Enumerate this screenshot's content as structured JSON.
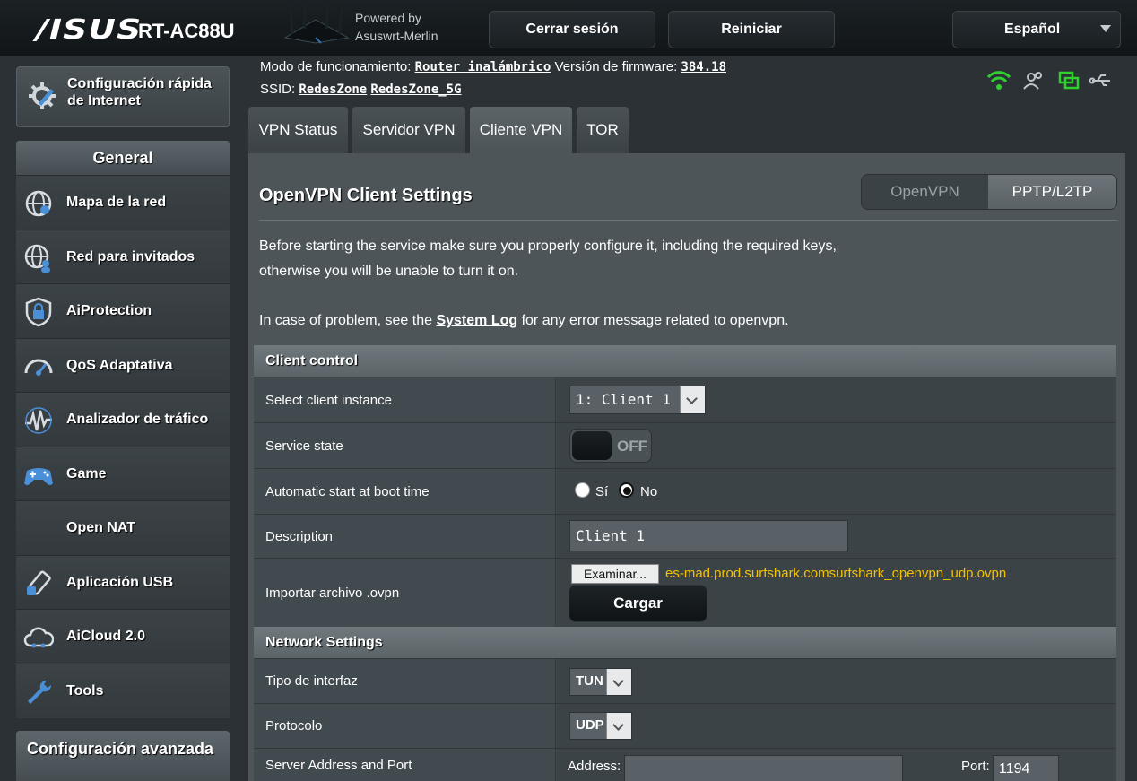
{
  "header": {
    "logo": "/ISUS",
    "model": "RT-AC88U",
    "powered_line1": "Powered by",
    "powered_line2": "Asuswrt-Merlin",
    "logout": "Cerrar sesión",
    "reboot": "Reiniciar",
    "language": "Español"
  },
  "sidebar": {
    "quick_setup": "Configuración rápida de Internet",
    "general_header": "General",
    "items": [
      {
        "label": "Mapa de la red",
        "icon": "network-map-icon"
      },
      {
        "label": "Red para invitados",
        "icon": "guest-network-icon"
      },
      {
        "label": "AiProtection",
        "icon": "aiprotection-lock-icon"
      },
      {
        "label": "QoS Adaptativa",
        "icon": "qos-gauge-icon"
      },
      {
        "label": "Analizador de tráfico",
        "icon": "traffic-analyzer-icon"
      },
      {
        "label": "Game",
        "icon": "gamepad-icon"
      },
      {
        "label": "Open NAT",
        "icon": ""
      },
      {
        "label": "Aplicación USB",
        "icon": "usb-application-icon"
      },
      {
        "label": "AiCloud 2.0",
        "icon": "cloud-icon"
      },
      {
        "label": "Tools",
        "icon": "wrench-icon"
      }
    ],
    "advanced_header": "Configuración avanzada"
  },
  "info": {
    "mode_label": "Modo de funcionamiento:",
    "mode_value": "Router inalámbrico",
    "fw_label": "Versión de firmware:",
    "fw_value": "384.18",
    "ssid_label": "SSID:",
    "ssid_1": "RedesZone",
    "ssid_2": "RedesZone_5G"
  },
  "tabs": [
    "VPN Status",
    "Servidor VPN",
    "Cliente VPN",
    "TOR"
  ],
  "panel": {
    "title": "OpenVPN Client Settings",
    "seg_openvpn": "OpenVPN",
    "seg_pptp": "PPTP/L2TP",
    "desc_line1": "Before starting the service make sure you properly configure it, including the required keys,",
    "desc_line2": "otherwise you will be unable to turn it on.",
    "desc_prefix": "In case of problem, see the ",
    "desc_link": "System Log",
    "desc_suffix": " for any error message related to openvpn."
  },
  "client_control": {
    "header": "Client control",
    "instance_label": "Select client instance",
    "instance_value": "1: Client 1",
    "service_label": "Service state",
    "service_value": "OFF",
    "autostart_label": "Automatic start at boot time",
    "autostart_yes": "Sí",
    "autostart_no": "No",
    "desc_label": "Description",
    "desc_value": "Client 1",
    "import_label": "Importar archivo .ovpn",
    "browse_label": "Examinar...",
    "file_name": "es-mad.prod.surfshark.comsurfshark_openvpn_udp.ovpn",
    "upload_label": "Cargar"
  },
  "network": {
    "header": "Network Settings",
    "iface_label": "Tipo de interfaz",
    "iface_value": "TUN",
    "proto_label": "Protocolo",
    "proto_value": "UDP",
    "server_label": "Server Address and Port",
    "address_label": "Address:",
    "address_value": "",
    "port_label": "Port:",
    "port_value": "1194"
  }
}
